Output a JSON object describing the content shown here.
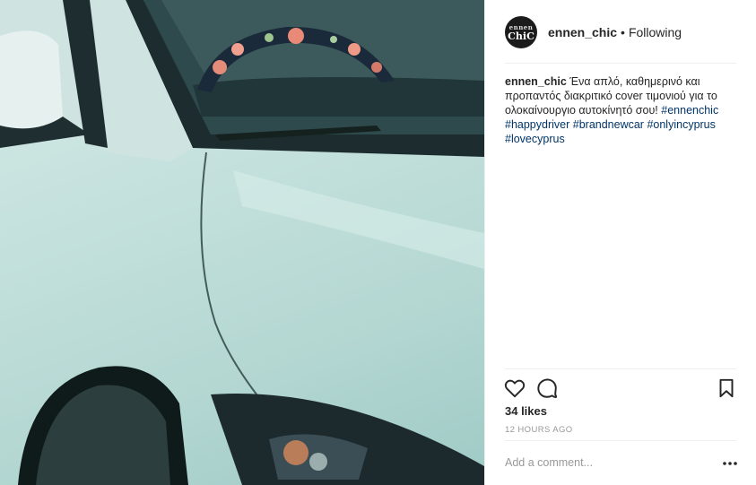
{
  "post": {
    "image_alt": "White car hood with floral steering wheel cover visible through windshield",
    "avatar": {
      "line1": "ennen",
      "line2": "ChiC"
    },
    "username": "ennen_chic",
    "separator": "•",
    "follow_status": "Following"
  },
  "caption": {
    "username": "ennen_chic",
    "text": "Ένα απλό, καθημερινό και προπαντός διακριτικό cover τιμονιού για το ολοκαίνουργιο αυτοκίνητό σου!",
    "hashtags": [
      "#ennenchic",
      "#happydriver",
      "#brandnewcar",
      "#onlyincyprus",
      "#lovecyprus"
    ]
  },
  "actions": {
    "like_icon": "heart-icon",
    "comment_icon": "comment-icon",
    "save_icon": "bookmark-icon"
  },
  "likes": "34 likes",
  "timestamp": "12 HOURS AGO",
  "comment": {
    "placeholder": "Add a comment...",
    "more_icon": "more-options-icon"
  },
  "colors": {
    "text": "#262626",
    "hashtag": "#003569",
    "muted": "#999999",
    "divider": "#efefef"
  }
}
